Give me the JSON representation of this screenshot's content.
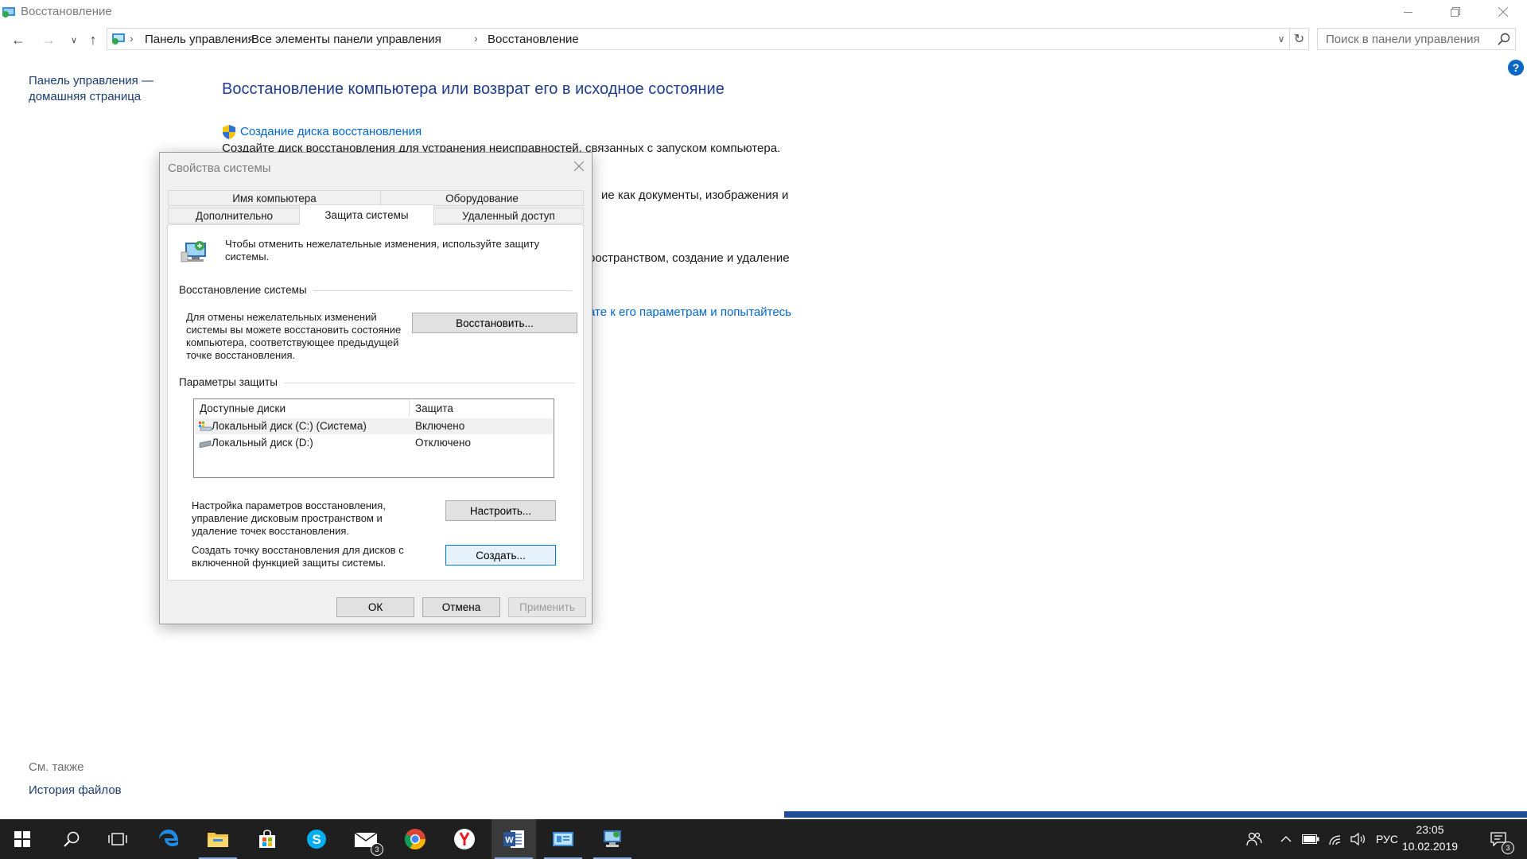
{
  "window": {
    "title": "Восстановление"
  },
  "breadcrumb": [
    "Панель управления",
    "Все элементы панели управления",
    "Восстановление"
  ],
  "search": {
    "placeholder": "Поиск в панели управления"
  },
  "left_pane": {
    "home_link": "Панель управления — домашняя страница",
    "see_also": "См. также",
    "history_link": "История файлов"
  },
  "main": {
    "title": "Восстановление компьютера или возврат его в исходное состояние",
    "create_disk_link": "Создание диска восстановления",
    "create_disk_desc": "Создайте диск восстановления для устранения неисправностей, связанных с запуском компьютера.",
    "fragment_1": "ие как документы, изображения и",
    "fragment_2": "оостранством, создание и удаление",
    "fragment_3_link": "ате к его параметрам и попытайтесь"
  },
  "dialog": {
    "title": "Свойства системы",
    "tabs_row1": [
      "Имя компьютера",
      "Оборудование"
    ],
    "tabs_row2": [
      "Дополнительно",
      "Защита системы",
      "Удаленный доступ"
    ],
    "intro": "Чтобы отменить нежелательные изменения, используйте защиту системы.",
    "restore_group": "Восстановление системы",
    "restore_desc": "Для отмены нежелательных изменений системы вы можете восстановить состояние компьютера, соответствующее предыдущей точке восстановления.",
    "restore_button": "Восстановить...",
    "protection_group": "Параметры защиты",
    "list_headers": [
      "Доступные диски",
      "Защита"
    ],
    "drives": [
      {
        "name": "Локальный диск (C:) (Система)",
        "status": "Включено"
      },
      {
        "name": "Локальный диск (D:)",
        "status": "Отключено"
      }
    ],
    "configure_desc": "Настройка параметров восстановления, управление дисковым пространством и удаление точек восстановления.",
    "configure_button": "Настроить...",
    "create_desc": "Создать точку восстановления для дисков с включенной функцией защиты системы.",
    "create_button": "Создать...",
    "ok": "ОК",
    "cancel": "Отмена",
    "apply": "Применить"
  },
  "taskbar": {
    "language": "РУС",
    "time": "23:05",
    "date": "10.02.2019",
    "mail_badge": "3",
    "notification_badge": "3",
    "icons": [
      "windows-start-icon",
      "search-icon",
      "task-view-icon",
      "edge-icon",
      "file-explorer-icon",
      "store-icon",
      "skype-icon",
      "mail-icon",
      "chrome-icon",
      "yandex-browser-icon",
      "word-icon",
      "control-panel-icon",
      "system-properties-icon"
    ]
  },
  "colors": {
    "link": "#0066cc",
    "title_blue": "#1e3d8f",
    "taskbar": "#1f1f1f",
    "focus_border": "#0078d7"
  }
}
